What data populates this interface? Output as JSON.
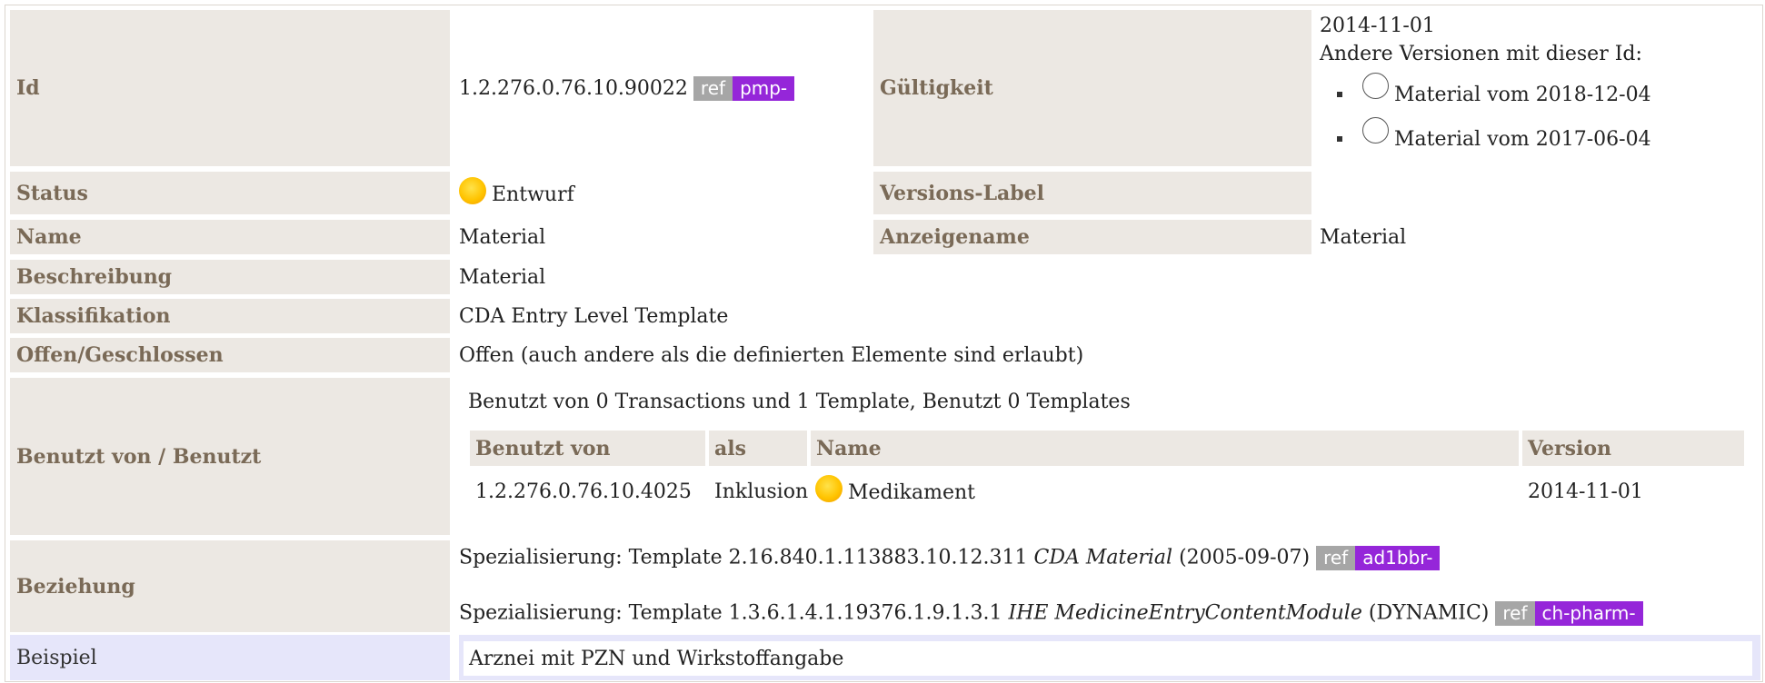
{
  "rows": {
    "id": {
      "label": "Id",
      "value": "1.2.276.0.76.10.90022",
      "ref": "ref",
      "project": "pmp-"
    },
    "validity": {
      "label": "Gültigkeit",
      "date": "2014-11-01",
      "other_versions_label": "Andere Versionen mit dieser Id:",
      "versions": [
        {
          "label": "Material vom 2018-12-04"
        },
        {
          "label": "Material vom 2017-06-04"
        }
      ]
    },
    "status": {
      "label": "Status",
      "value": "Entwurf"
    },
    "version_label": {
      "label": "Versions-Label",
      "value": ""
    },
    "name": {
      "label": "Name",
      "value": "Material"
    },
    "display_name": {
      "label": "Anzeigename",
      "value": "Material"
    },
    "description": {
      "label": "Beschreibung",
      "value": "Material"
    },
    "classification": {
      "label": "Klassifikation",
      "value": "CDA Entry Level Template"
    },
    "open_closed": {
      "label": "Offen/Geschlossen",
      "value": "Offen (auch andere als die definierten Elemente sind erlaubt)"
    },
    "used_by": {
      "label": "Benutzt von / Benutzt",
      "summary": "Benutzt von 0 Transactions und 1 Template, Benutzt 0 Templates",
      "headers": [
        "Benutzt von",
        "als",
        "Name",
        "Version"
      ],
      "rows": [
        {
          "id": "1.2.276.0.76.10.4025",
          "as": "Inklusion",
          "name": "Medikament",
          "version": "2014-11-01"
        }
      ]
    },
    "relationship": {
      "label": "Beziehung",
      "items": [
        {
          "prefix": "Spezialisierung: Template 2.16.840.1.113883.10.12.311",
          "name": "CDA Material",
          "suffix": "(2005-09-07)",
          "ref": "ref",
          "project": "ad1bbr-"
        },
        {
          "prefix": "Spezialisierung: Template 1.3.6.1.4.1.19376.1.9.1.3.1",
          "name": "IHE MedicineEntryContentModule",
          "suffix": "(DYNAMIC)",
          "ref": "ref",
          "project": "ch-pharm-"
        }
      ]
    },
    "example": {
      "label": "Beispiel",
      "value": "Arznei mit PZN und Wirkstoffangabe"
    }
  }
}
